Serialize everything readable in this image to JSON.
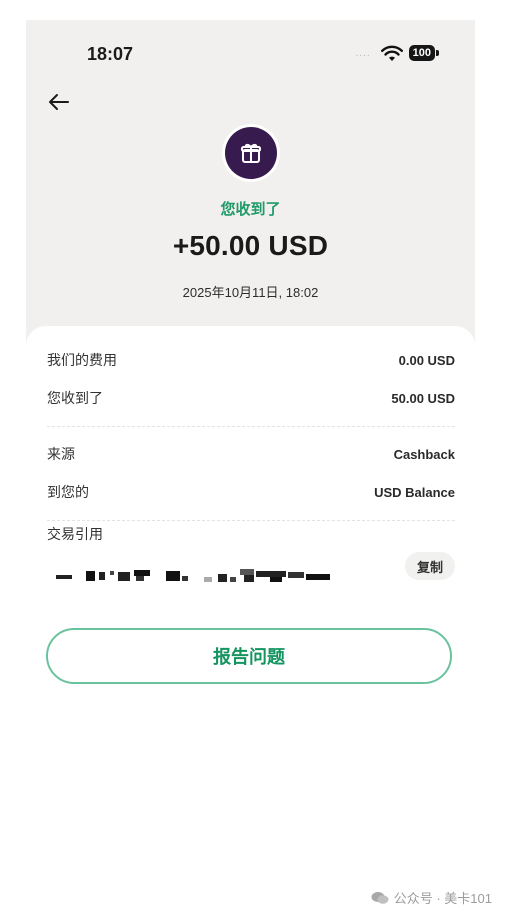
{
  "status_bar": {
    "time": "18:07",
    "signal": "....",
    "battery": "100",
    "icons": [
      "wifi-icon",
      "battery-icon"
    ]
  },
  "header": {
    "back_icon": "arrow-left-icon",
    "badge_icon": "gift-icon",
    "received_label": "您收到了",
    "amount": "+50.00 USD",
    "date": "2025年10月11日, 18:02"
  },
  "details": {
    "fee_label": "我们的费用",
    "fee_value": "0.00 USD",
    "received_label": "您收到了",
    "received_value": "50.00 USD",
    "source_label": "来源",
    "source_value": "Cashback",
    "to_label": "到您的",
    "to_value": "USD Balance",
    "reference_label": "交易引用",
    "copy_label": "复制"
  },
  "actions": {
    "report_label": "报告问题"
  },
  "watermark": {
    "text": "公众号 · 美卡101"
  },
  "colors": {
    "accent_green": "#1f9a68",
    "gift_purple": "#371b4e",
    "header_bg": "#f1f0ee",
    "button_border": "#69c39c"
  }
}
